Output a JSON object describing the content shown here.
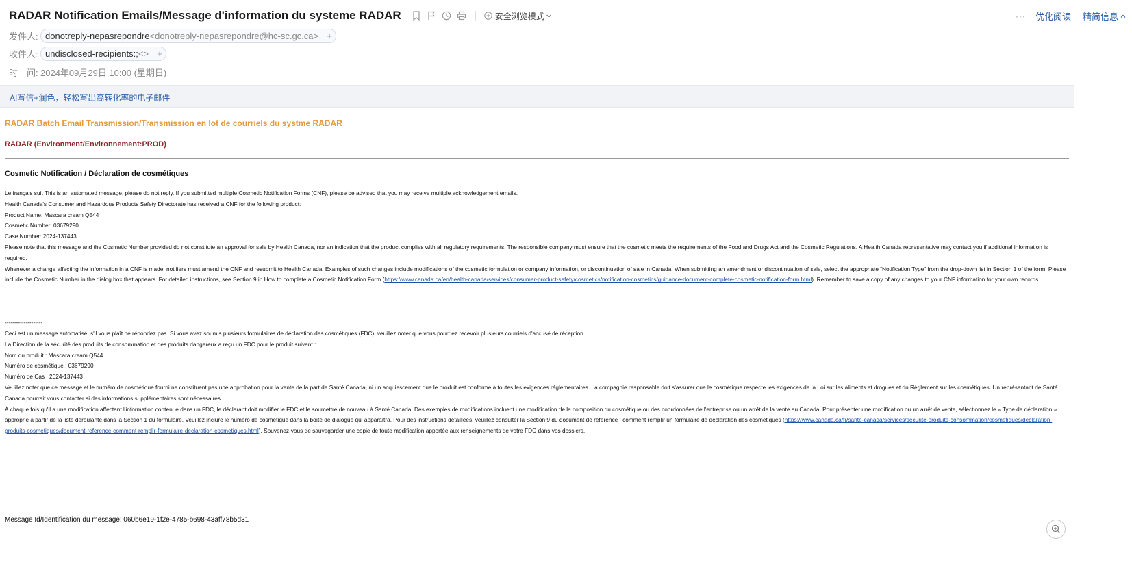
{
  "header": {
    "subject": "RADAR Notification Emails/Message d'information du systeme RADAR",
    "safe_mode_label": "安全浏览模式",
    "actions": {
      "more": "···",
      "optimize_read": "优化阅读",
      "brief_info": "精简信息"
    },
    "from": {
      "label": "发件人:",
      "name": "donotreply-nepasrepondre",
      "address": "<donotreply-nepasrepondre@hc-sc.gc.ca>"
    },
    "to": {
      "label": "收件人:",
      "name": "undisclosed-recipients:;",
      "address": "<>"
    },
    "time": {
      "label": "时　间:",
      "value": "2024年09月29日 10:00 (星期日)"
    }
  },
  "ai_bar": {
    "text": "AI写信+润色，轻松写出高转化率的电子邮件"
  },
  "body": {
    "heading_orange": "RADAR Batch Email Transmission/Transmission en lot de courriels du systme RADAR",
    "heading_env": "RADAR (Environment/Environnement:PROD)",
    "heading_section": "Cosmetic Notification / Déclaration de cosmétiques",
    "en": {
      "line1": "Le français suit This is an automated message, please do not reply. If you submitted multiple Cosmetic Notification Forms (CNF), please be advised that you may receive multiple acknowledgement emails.",
      "line2": "Health Canada's Consumer and Hazardous Products Safety Directorate has received a CNF for the following product:",
      "product": "Product Name: Mascara cream Q544",
      "cosmetic_number": "Cosmetic Number: 03679290",
      "case_number": "Case Number: 2024-137443",
      "note": "Please note that this message and the Cosmetic Number provided do not constitute an approval for sale by Health Canada, nor an indication that the product complies with all regulatory requirements. The responsible company must ensure that the cosmetic meets the requirements of the Food and Drugs Act and the Cosmetic Regulations. A Health Canada representative may contact you if additional information is required.",
      "change_before": "Whenever a change affecting the information in a CNF is made, notifiers must amend the CNF and resubmit to Health Canada. Examples of such changes include modifications of the cosmetic formulation or company information, or discontinuation of sale in Canada. When submitting an amendment or discontinuation of sale, select the appropriate “Notification Type” from the drop-down list in Section 1 of the form. Please include the Cosmetic Number in the dialog box that appears. For detailed instructions, see Section 9 in How to complete a Cosmetic Notification Form (",
      "link": "https://www.canada.ca/en/health-canada/services/consumer-product-safety/cosmetics/notification-cosmetics/guidance-document-complete-cosmetic-notification-form.html",
      "change_after": "). Remember to save a copy of any changes to your CNF information for your own records."
    },
    "divider": "--------------------",
    "fr": {
      "line1": "Ceci est un message automatisé, s'il vous plaît ne répondez pas. Si vous avez soumis plusieurs formulaires de déclaration des cosmétiques (FDC), veuillez noter que vous pourriez recevoir plusieurs courriels d'accusé de réception.",
      "line2": "La Direction de la sécurité des produits de consommation et des produits dangereux a reçu un FDC pour le produit suivant :",
      "product": "Nom du produit : Mascara cream Q544",
      "cosmetic_number": "Numéro de cosmétique : 03679290",
      "case_number": "Numéro de Cas : 2024-137443",
      "note": "Veuillez noter que ce message et le numéro de cosmétique fourni ne constituent pas une approbation pour la vente de la part de Santé Canada, ni un acquiescement que le produit est conforme à toutes les exigences réglementaires. La compagnie responsable doit s'assurer que le cosmétique respecte les exigences de la Loi sur les aliments et drogues et du Règlement sur les cosmétiques. Un représentant de Santé Canada pourrait vous contacter si des informations supplémentaires sont nécessaires.",
      "change_before": "À chaque fois qu'il a une modification affectant l'information contenue dans un FDC, le déclarant doit modifier le FDC et le soumettre de nouveau à Santé Canada. Des exemples de modifications incluent une modification de la composition du cosmétique ou des coordonnées de l'entreprise ou un arrêt de la vente au Canada. Pour présenter une modification ou un arrêt de vente, sélectionnez le « Type de déclaration » approprié à partir de la liste déroulante dans la Section 1 du formulaire. Veuillez inclure le numéro de cosmétique dans la boîte de dialogue qui apparaîtra. Pour des instructions détaillées, veuillez consulter la Section 9 du document de référence : comment remplir un formulaire de déclaration des cosmétiques (",
      "link": "https://www.canada.ca/fr/sante-canada/services/securite-produits-consommation/cosmetiques/declaration-produits-cosmetiques/document-reference-comment-remplir-formulaire-declaration-cosmetiques.html",
      "change_after": "). Souvenez-vous de sauvegarder une copie de toute modification apportée aux renseignements de votre FDC dans vos dossiers."
    },
    "message_id": "Message Id/Identification du message: 060b6e19-1f2e-4785-b698-43aff78b5d31"
  },
  "icons": [
    "bookmark-icon",
    "flag-icon",
    "clock-icon",
    "print-icon",
    "shield-plus-icon",
    "chevron-down-icon",
    "chevron-up-icon",
    "zoom-in-icon"
  ]
}
